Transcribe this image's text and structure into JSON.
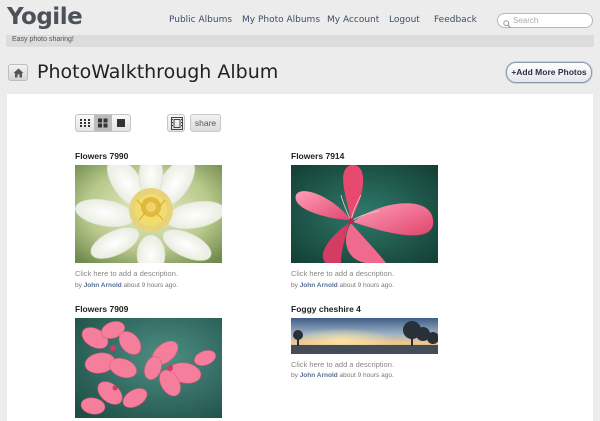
{
  "app": {
    "logo": "Yogile",
    "tagline": "Easy photo sharing!"
  },
  "nav": {
    "items": [
      "Public Albums",
      "My Photo Albums",
      "My Account",
      "Logout",
      "Feedback"
    ]
  },
  "search": {
    "placeholder": "Search",
    "icon": "search-icon"
  },
  "page": {
    "title": "PhotoWalkthrough Album",
    "add_photos_label": "+Add More Photos",
    "home_icon": "home-icon"
  },
  "toolbar": {
    "view_modes": [
      "small-grid",
      "medium-grid",
      "large"
    ],
    "active_view": "medium-grid",
    "slideshow_icon": "film-icon",
    "share_label": "share"
  },
  "photos": [
    {
      "title": "Flowers 7990",
      "description": "Click here to add a description.",
      "by": "by",
      "author": "John Arnold",
      "time": "about 9 hours ago."
    },
    {
      "title": "Flowers 7914",
      "description": "Click here to add a description.",
      "by": "by",
      "author": "John Arnold",
      "time": "about 9 hours ago."
    },
    {
      "title": "Flowers 7909"
    },
    {
      "title": "Foggy cheshire 4",
      "description": "Click here to add a description.",
      "by": "by",
      "author": "John Arnold",
      "time": "about 9 hours ago."
    }
  ],
  "colors": {
    "background": "#ececec",
    "nav_link": "#3d4d6a",
    "author_link": "#566d94",
    "content_bg": "#ffffff"
  }
}
